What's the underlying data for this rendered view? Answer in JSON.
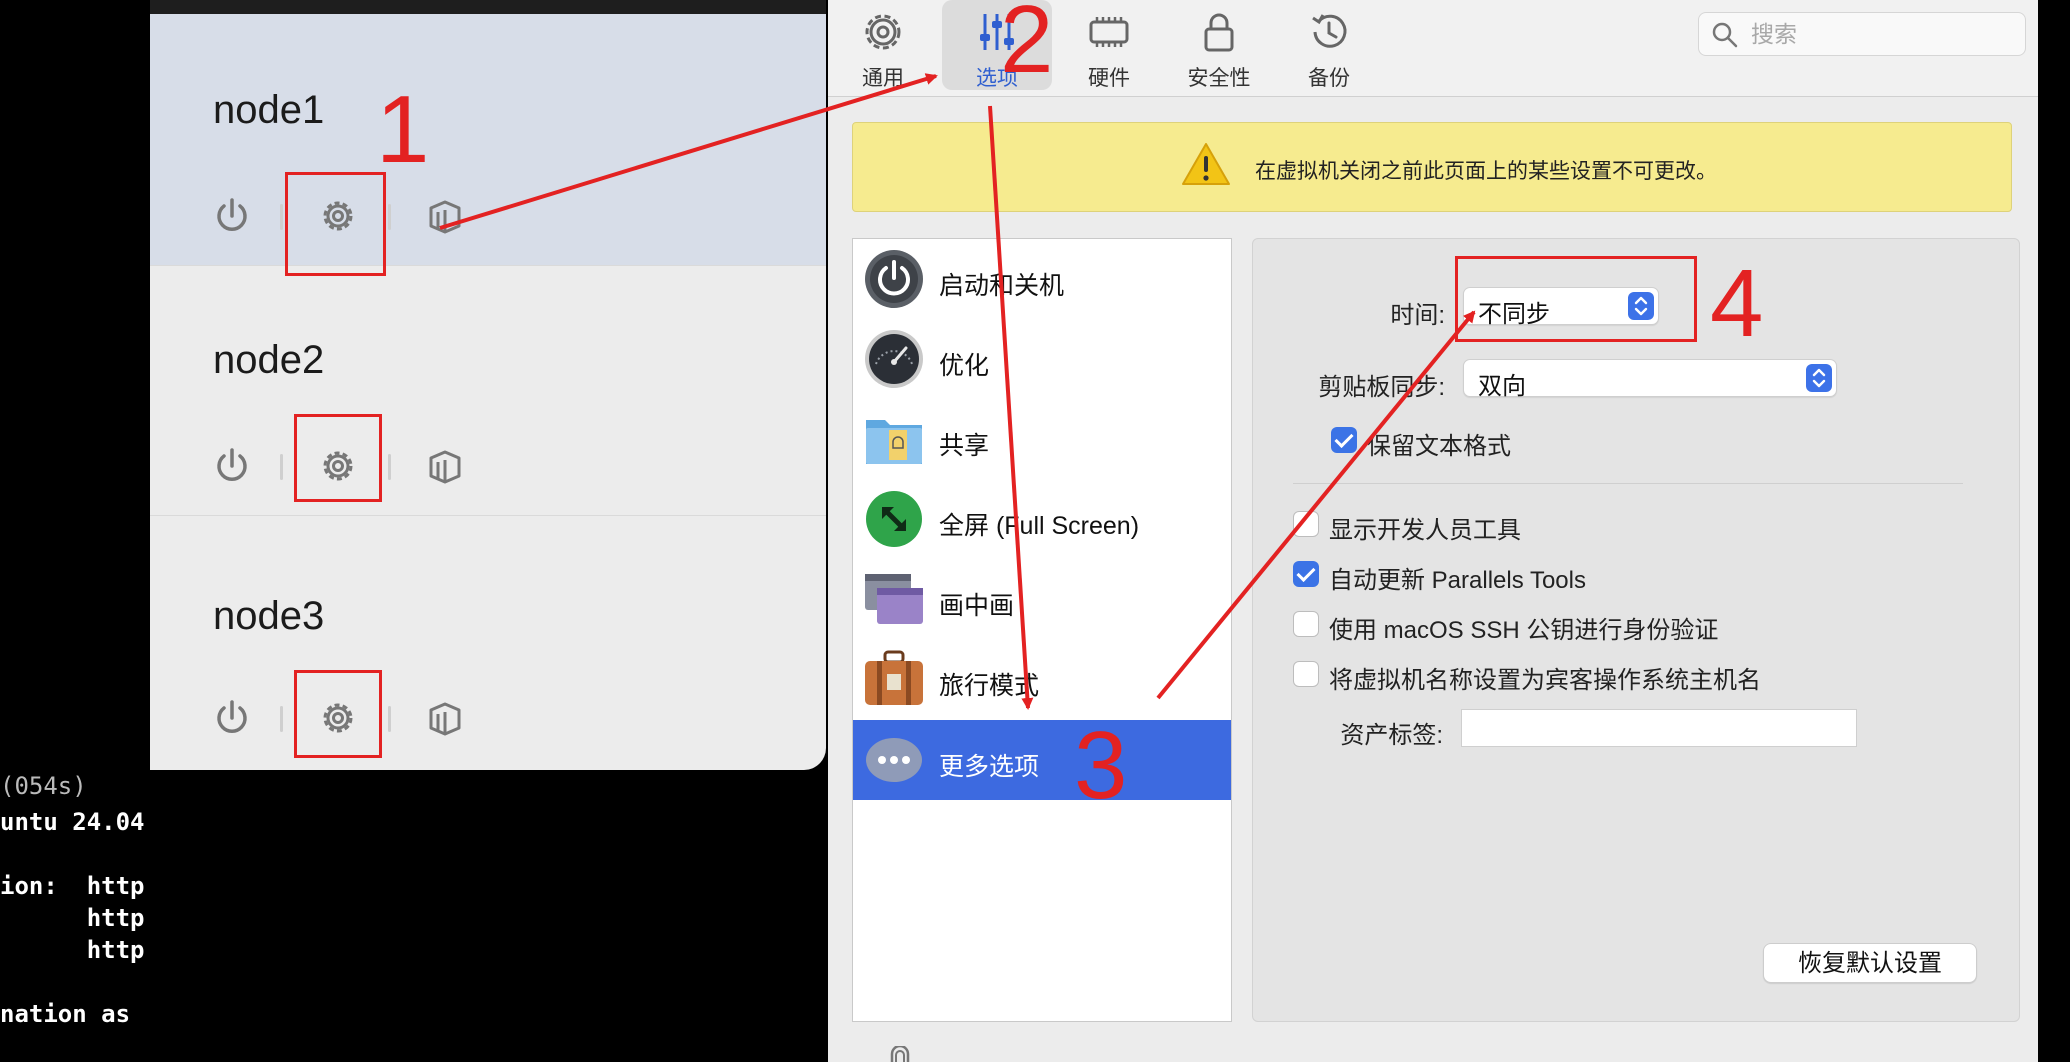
{
  "terminal": {
    "lines": [
      "(054s)",
      "untu 24.04",
      "",
      "ion:  http",
      "      http",
      "      http",
      "",
      "nation as"
    ]
  },
  "vm_list": {
    "items": [
      {
        "name": "node1"
      },
      {
        "name": "node2"
      },
      {
        "name": "node3"
      }
    ],
    "icons": {
      "power": "power-icon",
      "settings": "gear-icon",
      "clone": "copy-stack-icon"
    }
  },
  "toolbar": {
    "tabs": [
      {
        "label": "通用",
        "icon": "gear-icon"
      },
      {
        "label": "选项",
        "icon": "sliders-icon",
        "active": true
      },
      {
        "label": "硬件",
        "icon": "chip-icon"
      },
      {
        "label": "安全性",
        "icon": "lock-icon"
      },
      {
        "label": "备份",
        "icon": "clock-backup-icon"
      }
    ],
    "search_placeholder": "搜索"
  },
  "warning": {
    "text": "在虚拟机关闭之前此页面上的某些设置不可更改。"
  },
  "sidebar": {
    "items": [
      {
        "label": "启动和关机",
        "icon": "power-icon"
      },
      {
        "label": "优化",
        "icon": "speedometer-icon"
      },
      {
        "label": "共享",
        "icon": "shared-folder-icon"
      },
      {
        "label": "全屏 (Full Screen)",
        "icon": "fullscreen-icon"
      },
      {
        "label": "画中画",
        "icon": "picture-in-picture-icon"
      },
      {
        "label": "旅行模式",
        "icon": "suitcase-icon"
      },
      {
        "label": "更多选项",
        "icon": "more-options-icon",
        "selected": true
      }
    ]
  },
  "more_options": {
    "time_label": "时间:",
    "time_value": "不同步",
    "clipboard_label": "剪贴板同步:",
    "clipboard_value": "双向",
    "preserve_format": {
      "label": "保留文本格式",
      "checked": true
    },
    "checkboxes": [
      {
        "label": "显示开发人员工具",
        "checked": false
      },
      {
        "label": "自动更新 Parallels Tools",
        "checked": true
      },
      {
        "label": "使用 macOS SSH 公钥进行身份验证",
        "checked": false
      },
      {
        "label": "将虚拟机名称设置为宾客操作系统主机名",
        "checked": false
      }
    ],
    "asset_tag_label": "资产标签:",
    "asset_tag_value": "",
    "restore_button": "恢复默认设置"
  },
  "annotations": {
    "numbers": [
      "1",
      "2",
      "3",
      "4"
    ],
    "color": "#e32222"
  },
  "colors": {
    "accent": "#3d6ae0",
    "warning_bg": "#f6eb8f",
    "selected_vm": "#d7dde8"
  }
}
